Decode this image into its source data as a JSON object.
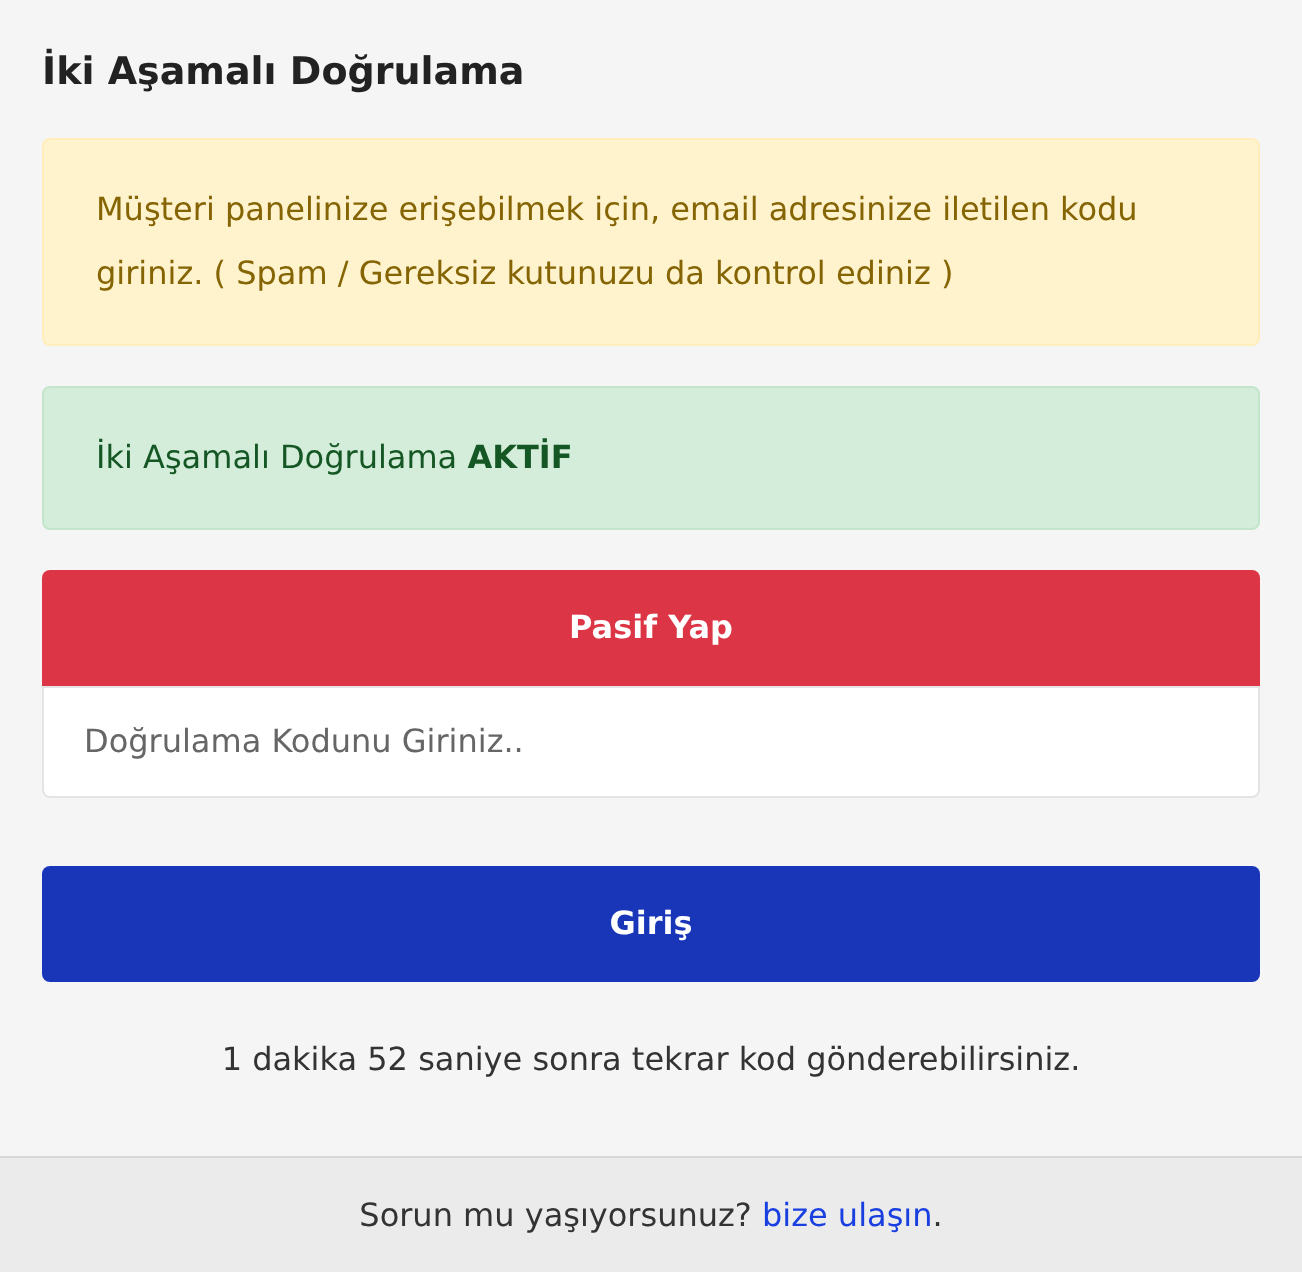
{
  "title": "İki Aşamalı Doğrulama",
  "alerts": [
    {
      "kind": "warning",
      "text": "Müşteri panelinize erişebilmek için, email adresinize iletilen kodu giriniz. ( Spam / Gereksiz kutunuzu da kontrol ediniz )"
    },
    {
      "kind": "success",
      "text": "İki Aşamalı Doğrulama **AKTİF**"
    }
  ],
  "deactivate_button": "Pasif Yap",
  "code_field": {
    "placeholder": "Doğrulama Kodunu Giriniz.."
  },
  "submit_button": "Giriş",
  "resend_note": "1 dakika 52 saniye sonra tekrar kod gönderebilirsiniz.",
  "footer": {
    "text": "Sorun mu yaşıyorsunuz?",
    "link": "bize ulaşın",
    "suffix": "."
  }
}
